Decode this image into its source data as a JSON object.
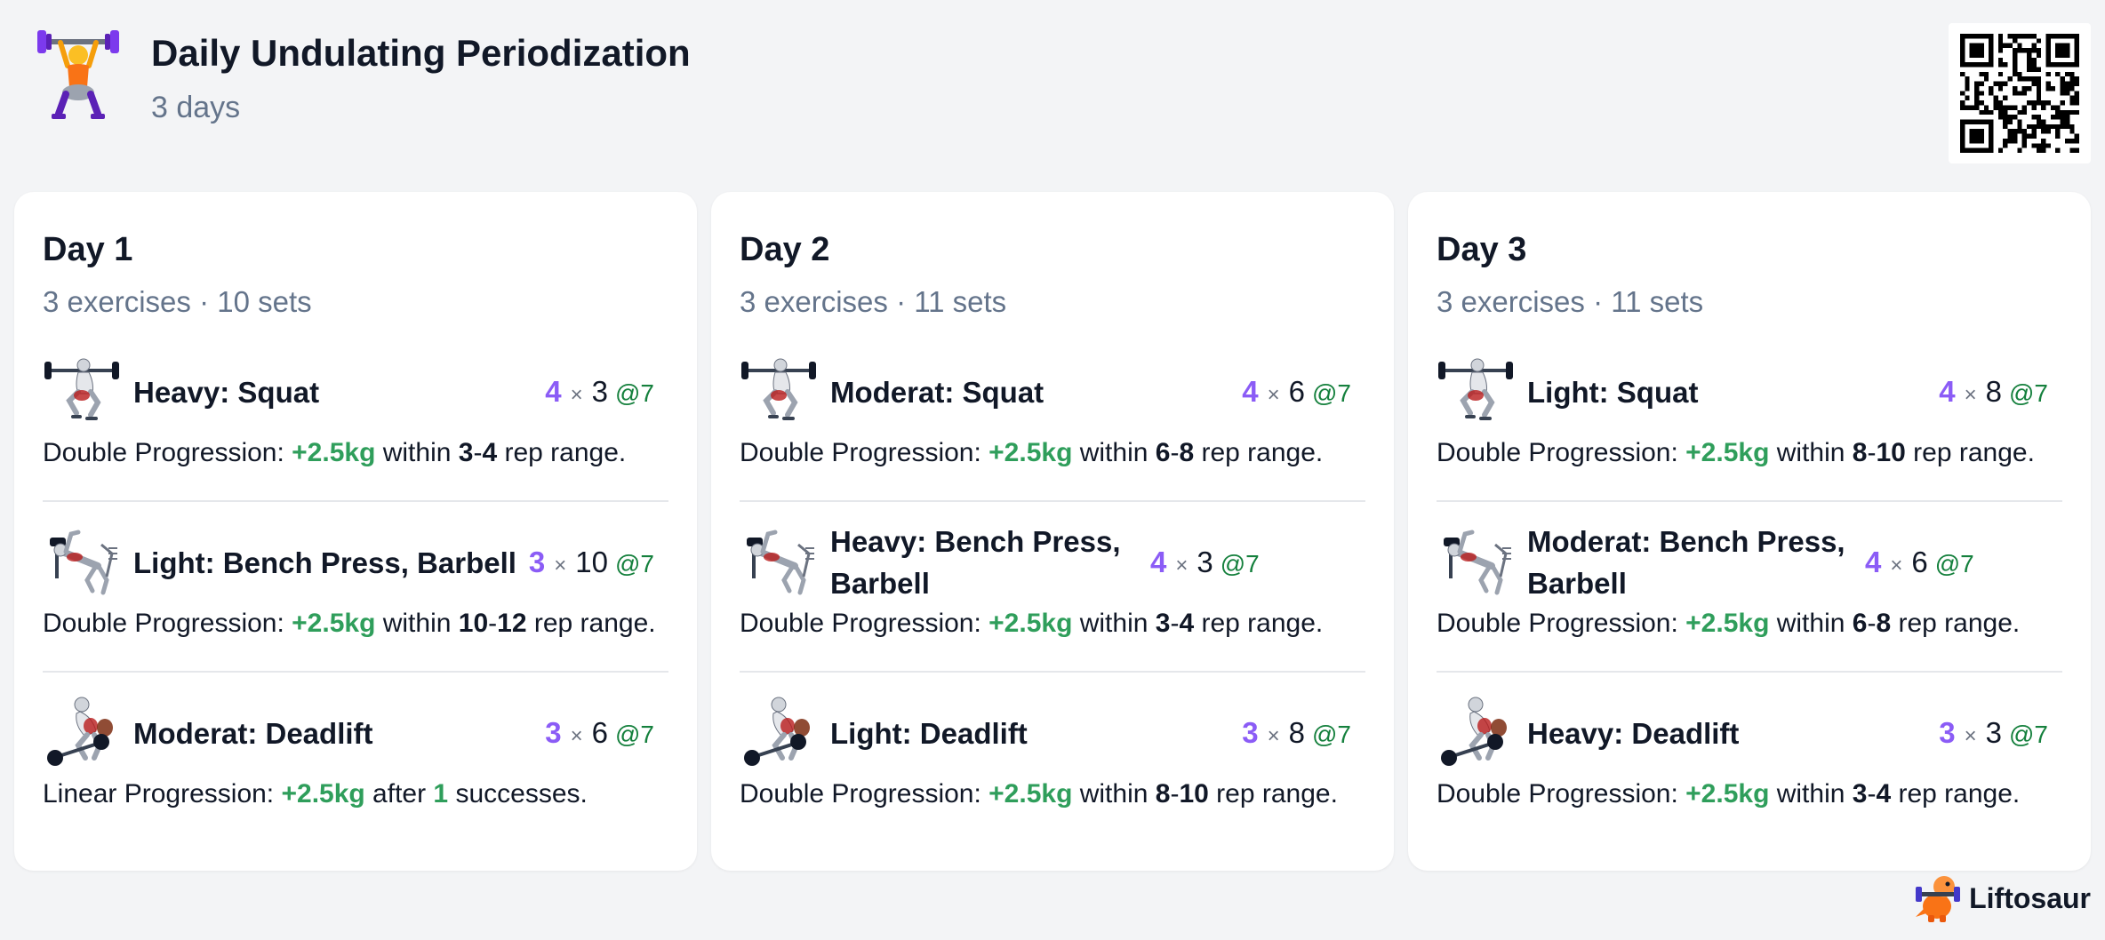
{
  "program": {
    "title": "Daily Undulating Periodization",
    "subtitle": "3 days"
  },
  "brand": {
    "name": "Liftosaur"
  },
  "colors": {
    "accent": "#8b5cf6",
    "positive": "#2f9e5b",
    "muted": "#64748b"
  },
  "days": [
    {
      "title": "Day 1",
      "meta": "3 exercises · 10 sets",
      "exercises": [
        {
          "name": "Heavy: Squat",
          "icon": "squat-icon",
          "sets": "4",
          "reps": "3",
          "rpe": "@7",
          "prog_pre": "Double Progression: ",
          "prog_weight": "+2.5kg",
          "prog_mid": " within ",
          "prog_a": "3",
          "prog_sep": "-",
          "prog_b": "4",
          "prog_post": " rep range."
        },
        {
          "name": "Light: Bench Press, Barbell",
          "icon": "bench-press-icon",
          "sets": "3",
          "reps": "10",
          "rpe": "@7",
          "prog_pre": "Double Progression: ",
          "prog_weight": "+2.5kg",
          "prog_mid": " within ",
          "prog_a": "10",
          "prog_sep": "-",
          "prog_b": "12",
          "prog_post": " rep range."
        },
        {
          "name": "Moderat: Deadlift",
          "icon": "deadlift-icon",
          "sets": "3",
          "reps": "6",
          "rpe": "@7",
          "prog_pre": "Linear Progression: ",
          "prog_weight": "+2.5kg",
          "prog_mid": " after ",
          "prog_a": "1",
          "prog_sep": "",
          "prog_b": "",
          "prog_post": " successes."
        }
      ]
    },
    {
      "title": "Day 2",
      "meta": "3 exercises · 11 sets",
      "exercises": [
        {
          "name": "Moderat: Squat",
          "icon": "squat-icon",
          "sets": "4",
          "reps": "6",
          "rpe": "@7",
          "prog_pre": "Double Progression: ",
          "prog_weight": "+2.5kg",
          "prog_mid": " within ",
          "prog_a": "6",
          "prog_sep": "-",
          "prog_b": "8",
          "prog_post": " rep range."
        },
        {
          "name": "Heavy: Bench Press, Barbell",
          "icon": "bench-press-icon",
          "sets": "4",
          "reps": "3",
          "rpe": "@7",
          "prog_pre": "Double Progression: ",
          "prog_weight": "+2.5kg",
          "prog_mid": " within ",
          "prog_a": "3",
          "prog_sep": "-",
          "prog_b": "4",
          "prog_post": " rep range."
        },
        {
          "name": "Light: Deadlift",
          "icon": "deadlift-icon",
          "sets": "3",
          "reps": "8",
          "rpe": "@7",
          "prog_pre": "Double Progression: ",
          "prog_weight": "+2.5kg",
          "prog_mid": " within ",
          "prog_a": "8",
          "prog_sep": "-",
          "prog_b": "10",
          "prog_post": " rep range."
        }
      ]
    },
    {
      "title": "Day 3",
      "meta": "3 exercises · 11 sets",
      "exercises": [
        {
          "name": "Light: Squat",
          "icon": "squat-icon",
          "sets": "4",
          "reps": "8",
          "rpe": "@7",
          "prog_pre": "Double Progression: ",
          "prog_weight": "+2.5kg",
          "prog_mid": " within ",
          "prog_a": "8",
          "prog_sep": "-",
          "prog_b": "10",
          "prog_post": " rep range."
        },
        {
          "name": "Moderat: Bench Press, Barbell",
          "icon": "bench-press-icon",
          "sets": "4",
          "reps": "6",
          "rpe": "@7",
          "prog_pre": "Double Progression: ",
          "prog_weight": "+2.5kg",
          "prog_mid": " within ",
          "prog_a": "6",
          "prog_sep": "-",
          "prog_b": "8",
          "prog_post": " rep range."
        },
        {
          "name": "Heavy: Deadlift",
          "icon": "deadlift-icon",
          "sets": "3",
          "reps": "3",
          "rpe": "@7",
          "prog_pre": "Double Progression: ",
          "prog_weight": "+2.5kg",
          "prog_mid": " within ",
          "prog_a": "3",
          "prog_sep": "-",
          "prog_b": "4",
          "prog_post": " rep range."
        }
      ]
    }
  ]
}
